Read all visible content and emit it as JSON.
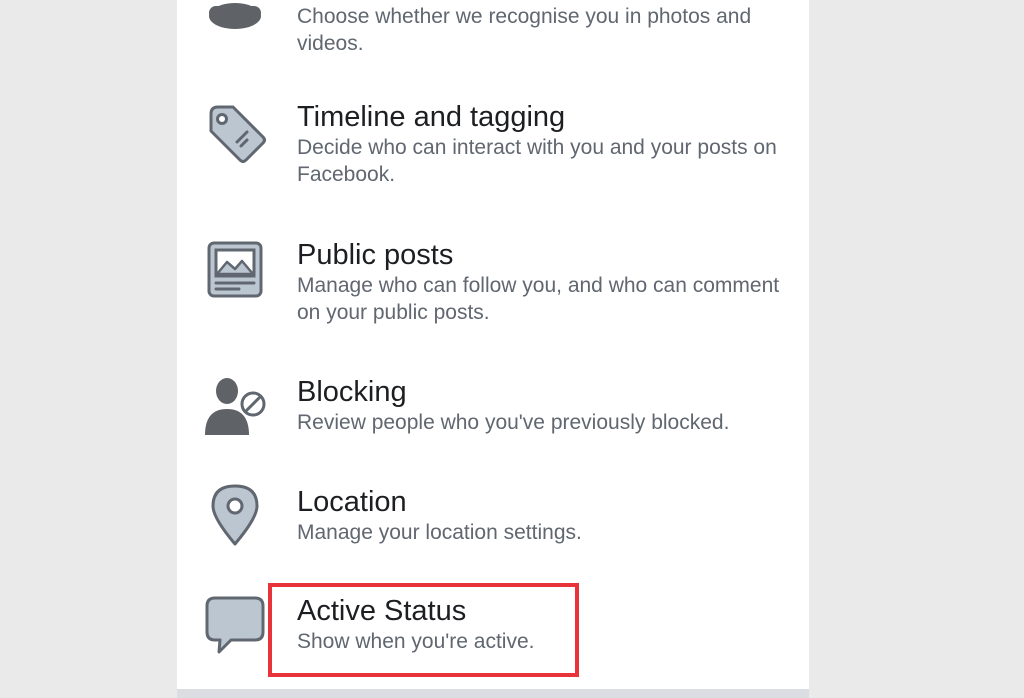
{
  "settings": {
    "items": [
      {
        "id": "face-recognition",
        "title": "",
        "description": "Choose whether we recognise you in photos and videos.",
        "icon": "face-recognition-icon"
      },
      {
        "id": "timeline-and-tagging",
        "title": "Timeline and tagging",
        "description": "Decide who can interact with you and your posts on Facebook.",
        "icon": "tag-icon"
      },
      {
        "id": "public-posts",
        "title": "Public posts",
        "description": "Manage who can follow you, and who can comment on your public posts.",
        "icon": "public-post-icon"
      },
      {
        "id": "blocking",
        "title": "Blocking",
        "description": "Review people who you've previously blocked.",
        "icon": "block-user-icon"
      },
      {
        "id": "location",
        "title": "Location",
        "description": "Manage your location settings.",
        "icon": "location-pin-icon"
      },
      {
        "id": "active-status",
        "title": "Active Status",
        "description": "Show when you're active.",
        "icon": "speech-bubble-icon"
      }
    ]
  },
  "colors": {
    "highlight": "#e8333a",
    "icon_fill": "#bcc6d0",
    "icon_stroke": "#606770",
    "icon_dark": "#5f6368",
    "title_text": "#1c1e21",
    "desc_text": "#606770"
  }
}
